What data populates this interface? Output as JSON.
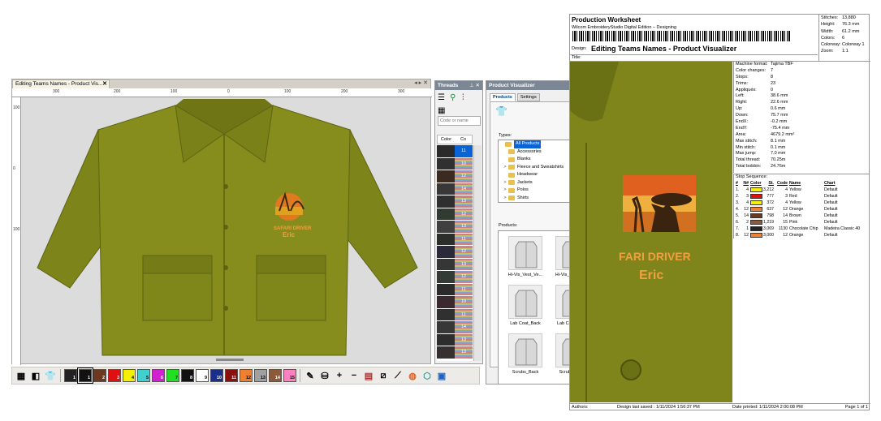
{
  "editor": {
    "tab_label": "Editing Teams Names - Product Vis...",
    "tab_close": "✕",
    "ruler_top": [
      "300",
      "200",
      "100",
      "0",
      "100",
      "200",
      "300"
    ],
    "ruler_left": [
      "100",
      "0",
      "100"
    ],
    "design_text_line1": "SAFARI DRIVER",
    "design_text_line2": "Eric"
  },
  "toolbar": {
    "swatches": [
      {
        "label": "1",
        "color": "#222222"
      },
      {
        "label": "1",
        "color": "#111111",
        "selected": true
      },
      {
        "label": "2",
        "color": "#6b3a1e"
      },
      {
        "label": "3",
        "color": "#e01010"
      },
      {
        "label": "4",
        "color": "#f4f000"
      },
      {
        "label": "5",
        "color": "#40d0d0"
      },
      {
        "label": "6",
        "color": "#d020d0"
      },
      {
        "label": "7",
        "color": "#20e020"
      },
      {
        "label": "8",
        "color": "#111111"
      },
      {
        "label": "9",
        "color": "#ffffff"
      },
      {
        "label": "10",
        "color": "#1a2f8a"
      },
      {
        "label": "11",
        "color": "#8a1010"
      },
      {
        "label": "12",
        "color": "#f08030"
      },
      {
        "label": "13",
        "color": "#a0a0a0"
      },
      {
        "label": "14",
        "color": "#8a5a3a"
      },
      {
        "label": "15",
        "color": "#ff80c0"
      }
    ],
    "icons": [
      "palette-icon",
      "fill-icon",
      "shirt-icon",
      "eyedropper-icon",
      "bucket-icon",
      "zoom-in-icon",
      "zoom-out-icon",
      "grid-icon",
      "ruler-icon",
      "edit-icon",
      "color-wheel-icon",
      "cube-icon",
      "frame-icon"
    ]
  },
  "threads": {
    "title": "Threads",
    "code_placeholder": "Code or name",
    "col_color": "Color",
    "col_code": "Co",
    "rows": [
      {
        "num": "11",
        "color": "#2a2a2a"
      },
      {
        "num": "10",
        "color": "#303030"
      },
      {
        "num": "12",
        "color": "#3a2a20"
      },
      {
        "num": "14",
        "color": "#383838"
      },
      {
        "num": "13",
        "color": "#2f2f2f"
      },
      {
        "num": "12",
        "color": "#303a30"
      },
      {
        "num": "13",
        "color": "#404040"
      },
      {
        "num": "11",
        "color": "#2a2f2a"
      },
      {
        "num": "12",
        "color": "#2a2a3a"
      },
      {
        "num": "13",
        "color": "#363636"
      },
      {
        "num": "12",
        "color": "#343a34"
      },
      {
        "num": "11",
        "color": "#2b2b2b"
      },
      {
        "num": "10",
        "color": "#3a2a30"
      },
      {
        "num": "11",
        "color": "#303030"
      },
      {
        "num": "14",
        "color": "#383838"
      },
      {
        "num": "13",
        "color": "#2d2d2d"
      },
      {
        "num": "13",
        "color": "#363030"
      }
    ]
  },
  "pv": {
    "title": "Product Visualizer",
    "tab_products": "Products",
    "tab_settings": "Settings",
    "types_label": "Types:",
    "products_label": "Products:",
    "types": [
      {
        "label": "All Products",
        "selected": true,
        "expand": ""
      },
      {
        "label": "Accessories",
        "expand": ""
      },
      {
        "label": "Blanks",
        "expand": ""
      },
      {
        "label": "Fleece and Sweatshirts",
        "expand": ">"
      },
      {
        "label": "Headwear",
        "expand": ""
      },
      {
        "label": "Jackets",
        "expand": ">"
      },
      {
        "label": "Polos",
        "expand": ">"
      },
      {
        "label": "Shirts",
        "expand": ">"
      }
    ],
    "products": [
      {
        "name": "Hi-Vis_Vest_Ve..."
      },
      {
        "name": "Hi-Vis_Vest_Ve..."
      },
      {
        "name": "Lab Coat_Back"
      },
      {
        "name": "Lab Coat_Front"
      },
      {
        "name": "Scrubs_Back"
      },
      {
        "name": "Scrubs_Front"
      }
    ]
  },
  "worksheet": {
    "title": "Production Worksheet",
    "subtitle": "Wilcom EmbroideryStudio Digital Edition – Designing",
    "design_label": "Design:",
    "design_name": "Editing Teams Names - Product Visualizer",
    "title_label": "Title:",
    "stats_top": [
      {
        "k": "Stitches:",
        "v": "13,880"
      },
      {
        "k": "Height:",
        "v": "76.3 mm"
      },
      {
        "k": "Width:",
        "v": "61.2 mm"
      },
      {
        "k": "Colors:",
        "v": "6"
      },
      {
        "k": "Colorway:",
        "v": "Colorway 1"
      },
      {
        "k": "Zoom:",
        "v": "1:1"
      }
    ],
    "machine": [
      {
        "k": "Machine format:",
        "v": "Tajima TBF"
      },
      {
        "k": "Color changes:",
        "v": "7"
      },
      {
        "k": "Stops:",
        "v": "8"
      },
      {
        "k": "Trims:",
        "v": "23"
      },
      {
        "k": "Appliqués:",
        "v": "0"
      },
      {
        "k": "Left:",
        "v": "38.6 mm"
      },
      {
        "k": "Right:",
        "v": "22.6 mm"
      },
      {
        "k": "Up:",
        "v": "0.6 mm"
      },
      {
        "k": "Down:",
        "v": "75.7 mm"
      },
      {
        "k": "EndX:",
        "v": "-0.2 mm"
      },
      {
        "k": "EndY:",
        "v": "-75.4 mm"
      },
      {
        "k": "Area:",
        "v": "4679.2 mm²"
      },
      {
        "k": "Max stitch:",
        "v": "8.1 mm"
      },
      {
        "k": "Min stitch:",
        "v": "0.1 mm"
      },
      {
        "k": "Max jump:",
        "v": "7.0 mm"
      },
      {
        "k": "Total thread:",
        "v": "70.25m"
      },
      {
        "k": "Total bobbin:",
        "v": "24.76m"
      }
    ],
    "stop_sequence_label": "Stop Sequence:",
    "stop_header": {
      "n": "#",
      "needle": "N#",
      "color": "Color",
      "st": "St.",
      "code": "Code",
      "name": "Name",
      "chart": "Chart"
    },
    "stops": [
      {
        "n": "1.",
        "needle": "4",
        "color": "#f4f000",
        "st": "3,212",
        "code": "4",
        "name": "Yellow",
        "chart": "Default"
      },
      {
        "n": "2.",
        "needle": "3",
        "color": "#e01010",
        "st": "777",
        "code": "3",
        "name": "Red",
        "chart": "Default"
      },
      {
        "n": "3.",
        "needle": "4",
        "color": "#f4f000",
        "st": "372",
        "code": "4",
        "name": "Yellow",
        "chart": "Default"
      },
      {
        "n": "4.",
        "needle": "12",
        "color": "#f08030",
        "st": "637",
        "code": "12",
        "name": "Orange",
        "chart": "Default"
      },
      {
        "n": "5.",
        "needle": "14",
        "color": "#6b3a1e",
        "st": "798",
        "code": "14",
        "name": "Brown",
        "chart": "Default"
      },
      {
        "n": "6.",
        "needle": "2",
        "color": "#8a5a3a",
        "st": "1,219",
        "code": "15",
        "name": "Pink",
        "chart": "Default"
      },
      {
        "n": "7.",
        "needle": "1",
        "color": "#222222",
        "st": "3,069",
        "code": "1130",
        "name": "Chocolate Chip",
        "chart": "Madeira Classic 40"
      },
      {
        "n": "8.",
        "needle": "12",
        "color": "#f08030",
        "st": "3,000",
        "code": "12",
        "name": "Orange",
        "chart": "Default"
      }
    ],
    "photo_text_line1": "FARI DRIVER",
    "photo_text_line2": "Eric",
    "footer_authors": "Authors:",
    "footer_saved": "Design last saved : 1/11/2024 1:56:37 PM",
    "footer_printed": "Date printed: 1/11/2024 2:00:08 PM",
    "footer_page": "Page 1 of 1"
  }
}
